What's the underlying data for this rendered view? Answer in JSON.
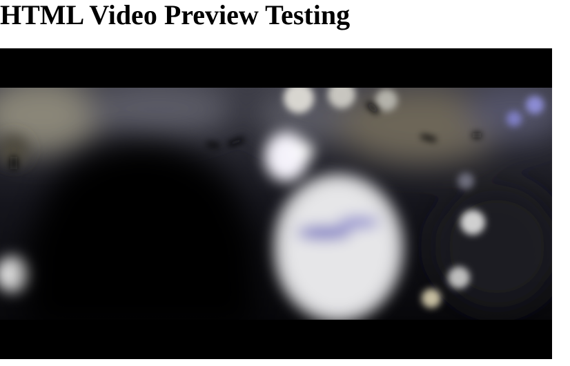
{
  "page": {
    "title": "HTML Video Preview Testing"
  },
  "video": {
    "frame_description_icon": "blurred-bokeh-video-frame",
    "letterbox_color": "#000000"
  }
}
